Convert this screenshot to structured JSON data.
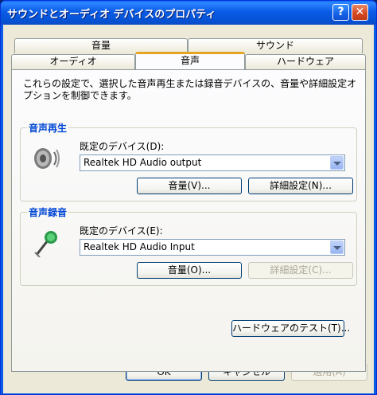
{
  "window": {
    "title": "サウンドとオーディオ デバイスのプロパティ",
    "help_glyph": "?",
    "close_glyph": "✕"
  },
  "tabs": {
    "top_row": [
      "音量",
      "サウンド"
    ],
    "bottom_row": [
      "オーディオ",
      "音声",
      "ハードウェア"
    ],
    "active": "音声"
  },
  "panel": {
    "description": "これらの設定で、選択した音声再生または録音デバイスの、音量や詳細設定オプションを制御できます。",
    "playback": {
      "legend": "音声再生",
      "default_device_label": "既定のデバイス(D):",
      "device": "Realtek HD Audio output",
      "volume_button": "音量(V)...",
      "advanced_button": "詳細設定(N)..."
    },
    "recording": {
      "legend": "音声録音",
      "default_device_label": "既定のデバイス(E):",
      "device": "Realtek HD Audio Input",
      "volume_button": "音量(O)...",
      "advanced_button": "詳細設定(C)..."
    },
    "test_hardware_button": "ハードウェアのテスト(T)..."
  },
  "footer": {
    "ok": "OK",
    "cancel": "キャンセル",
    "apply": "適用(A)"
  }
}
